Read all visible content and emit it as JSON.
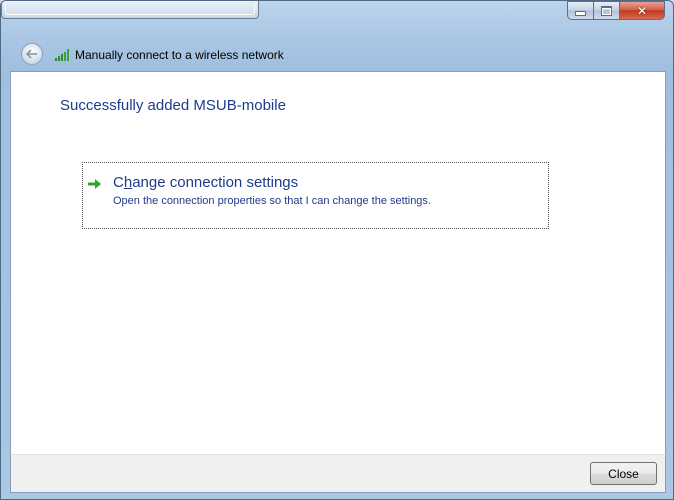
{
  "dialog": {
    "nav_title": "Manually connect to a wireless network",
    "heading": "Successfully added MSUB-mobile",
    "option": {
      "title_pre": "C",
      "title_accel": "h",
      "title_post": "ange connection settings",
      "description": "Open the connection properties so that I can change the settings."
    },
    "close_label": "Close",
    "caption": {
      "minimize": "",
      "maximize": "",
      "close": "✕"
    }
  },
  "icons": {
    "back": "back-arrow-icon",
    "network": "wireless-signal-icon",
    "option": "green-arrow-icon"
  },
  "colors": {
    "link_blue": "#1e3b8c",
    "arrow_green": "#2ea82e",
    "close_red": "#c2391f"
  }
}
